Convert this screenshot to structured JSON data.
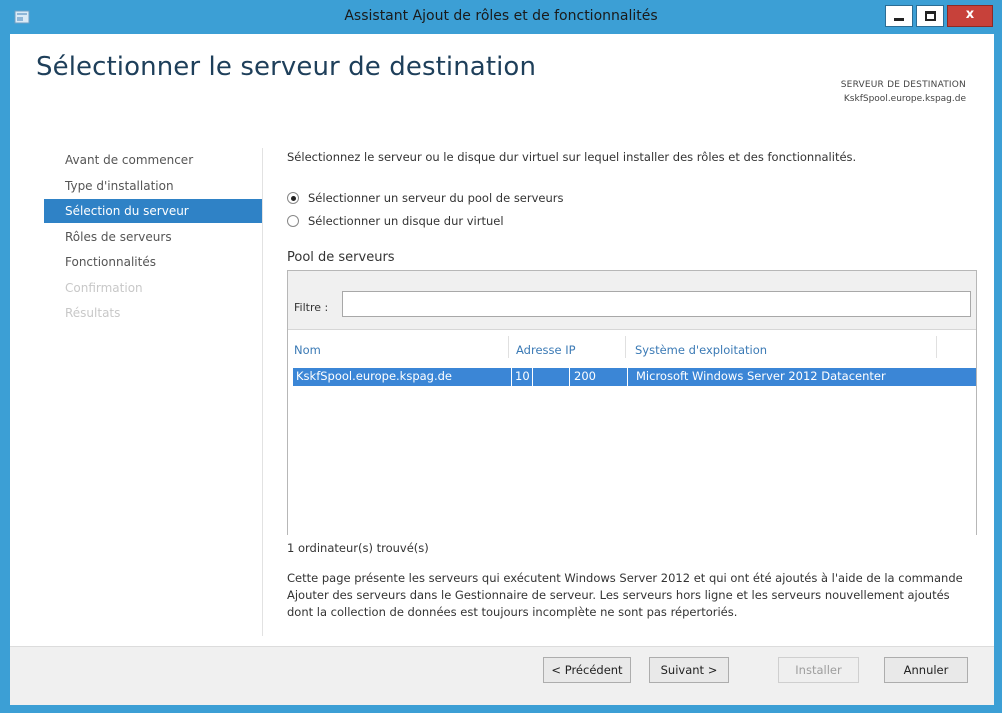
{
  "window": {
    "title": "Assistant Ajout de rôles et de fonctionnalités",
    "close_glyph": "x"
  },
  "page": {
    "title": "Sélectionner le serveur de destination",
    "destination_label": "SERVEUR DE DESTINATION",
    "destination_value": "KskfSpool.europe.kspag.de"
  },
  "nav": {
    "items": [
      {
        "label": "Avant de commencer",
        "state": "enabled"
      },
      {
        "label": "Type d'installation",
        "state": "enabled"
      },
      {
        "label": "Sélection du serveur",
        "state": "active"
      },
      {
        "label": "Rôles de serveurs",
        "state": "enabled"
      },
      {
        "label": "Fonctionnalités",
        "state": "enabled"
      },
      {
        "label": "Confirmation",
        "state": "disabled"
      },
      {
        "label": "Résultats",
        "state": "disabled"
      }
    ]
  },
  "main": {
    "instruction": "Sélectionnez le serveur ou le disque dur virtuel sur lequel installer des rôles et des fonctionnalités.",
    "radios": [
      {
        "label": "Sélectionner un serveur du pool de serveurs",
        "checked": true
      },
      {
        "label": "Sélectionner un disque dur virtuel",
        "checked": false
      }
    ],
    "pool": {
      "heading": "Pool de serveurs",
      "filter_label": "Filtre :",
      "filter_value": "",
      "columns": [
        "Nom",
        "Adresse IP",
        "Système d'exploitation"
      ],
      "rows": [
        {
          "name": "KskfSpool.europe.kspag.de",
          "ip_a": "10",
          "ip_b": "200",
          "os": "Microsoft Windows Server 2012 Datacenter",
          "selected": true
        }
      ]
    },
    "found_text": "1 ordinateur(s) trouvé(s)",
    "description": "Cette page présente les serveurs qui exécutent Windows Server 2012 et qui ont été ajoutés à l'aide de la commande Ajouter des serveurs dans le Gestionnaire de serveur. Les serveurs hors ligne et les serveurs nouvellement ajoutés dont la collection de données est toujours incomplète ne sont pas répertoriés."
  },
  "footer": {
    "previous": "< Précédent",
    "next": "Suivant >",
    "install": "Installer",
    "cancel": "Annuler"
  },
  "colors": {
    "frame": "#3c9fd5",
    "accent": "#2f82c6",
    "selection": "#3b86d6",
    "close": "#c7413a"
  }
}
